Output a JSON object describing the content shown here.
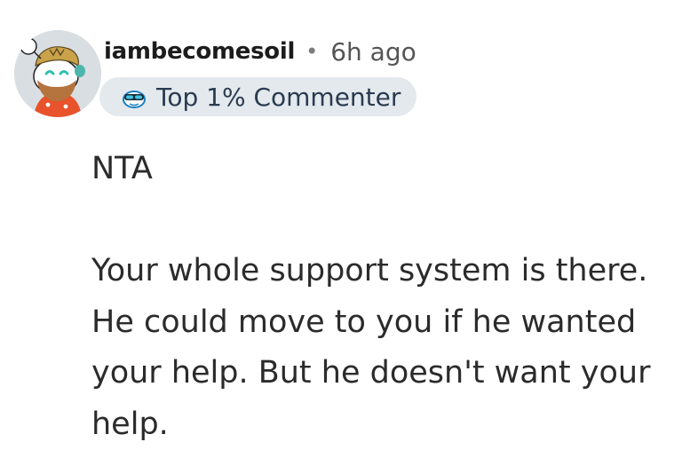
{
  "comment": {
    "author": {
      "username": "iambecomesoil",
      "avatar_icon": "snoo-avatar-with-beard-icon"
    },
    "separator": "•",
    "time_ago": "6h ago",
    "badge": {
      "icon": "top-commenter-snoo-icon",
      "label": "Top 1% Commenter"
    },
    "body": {
      "paragraph_1": "NTA",
      "paragraph_2": "Your whole support system is there. He could move to you if he wanted your help. But he doesn't want your help."
    }
  },
  "colors": {
    "badge_background": "#e4e9ee",
    "avatar_background": "#d9dee2",
    "text": "#2b2b2b"
  }
}
